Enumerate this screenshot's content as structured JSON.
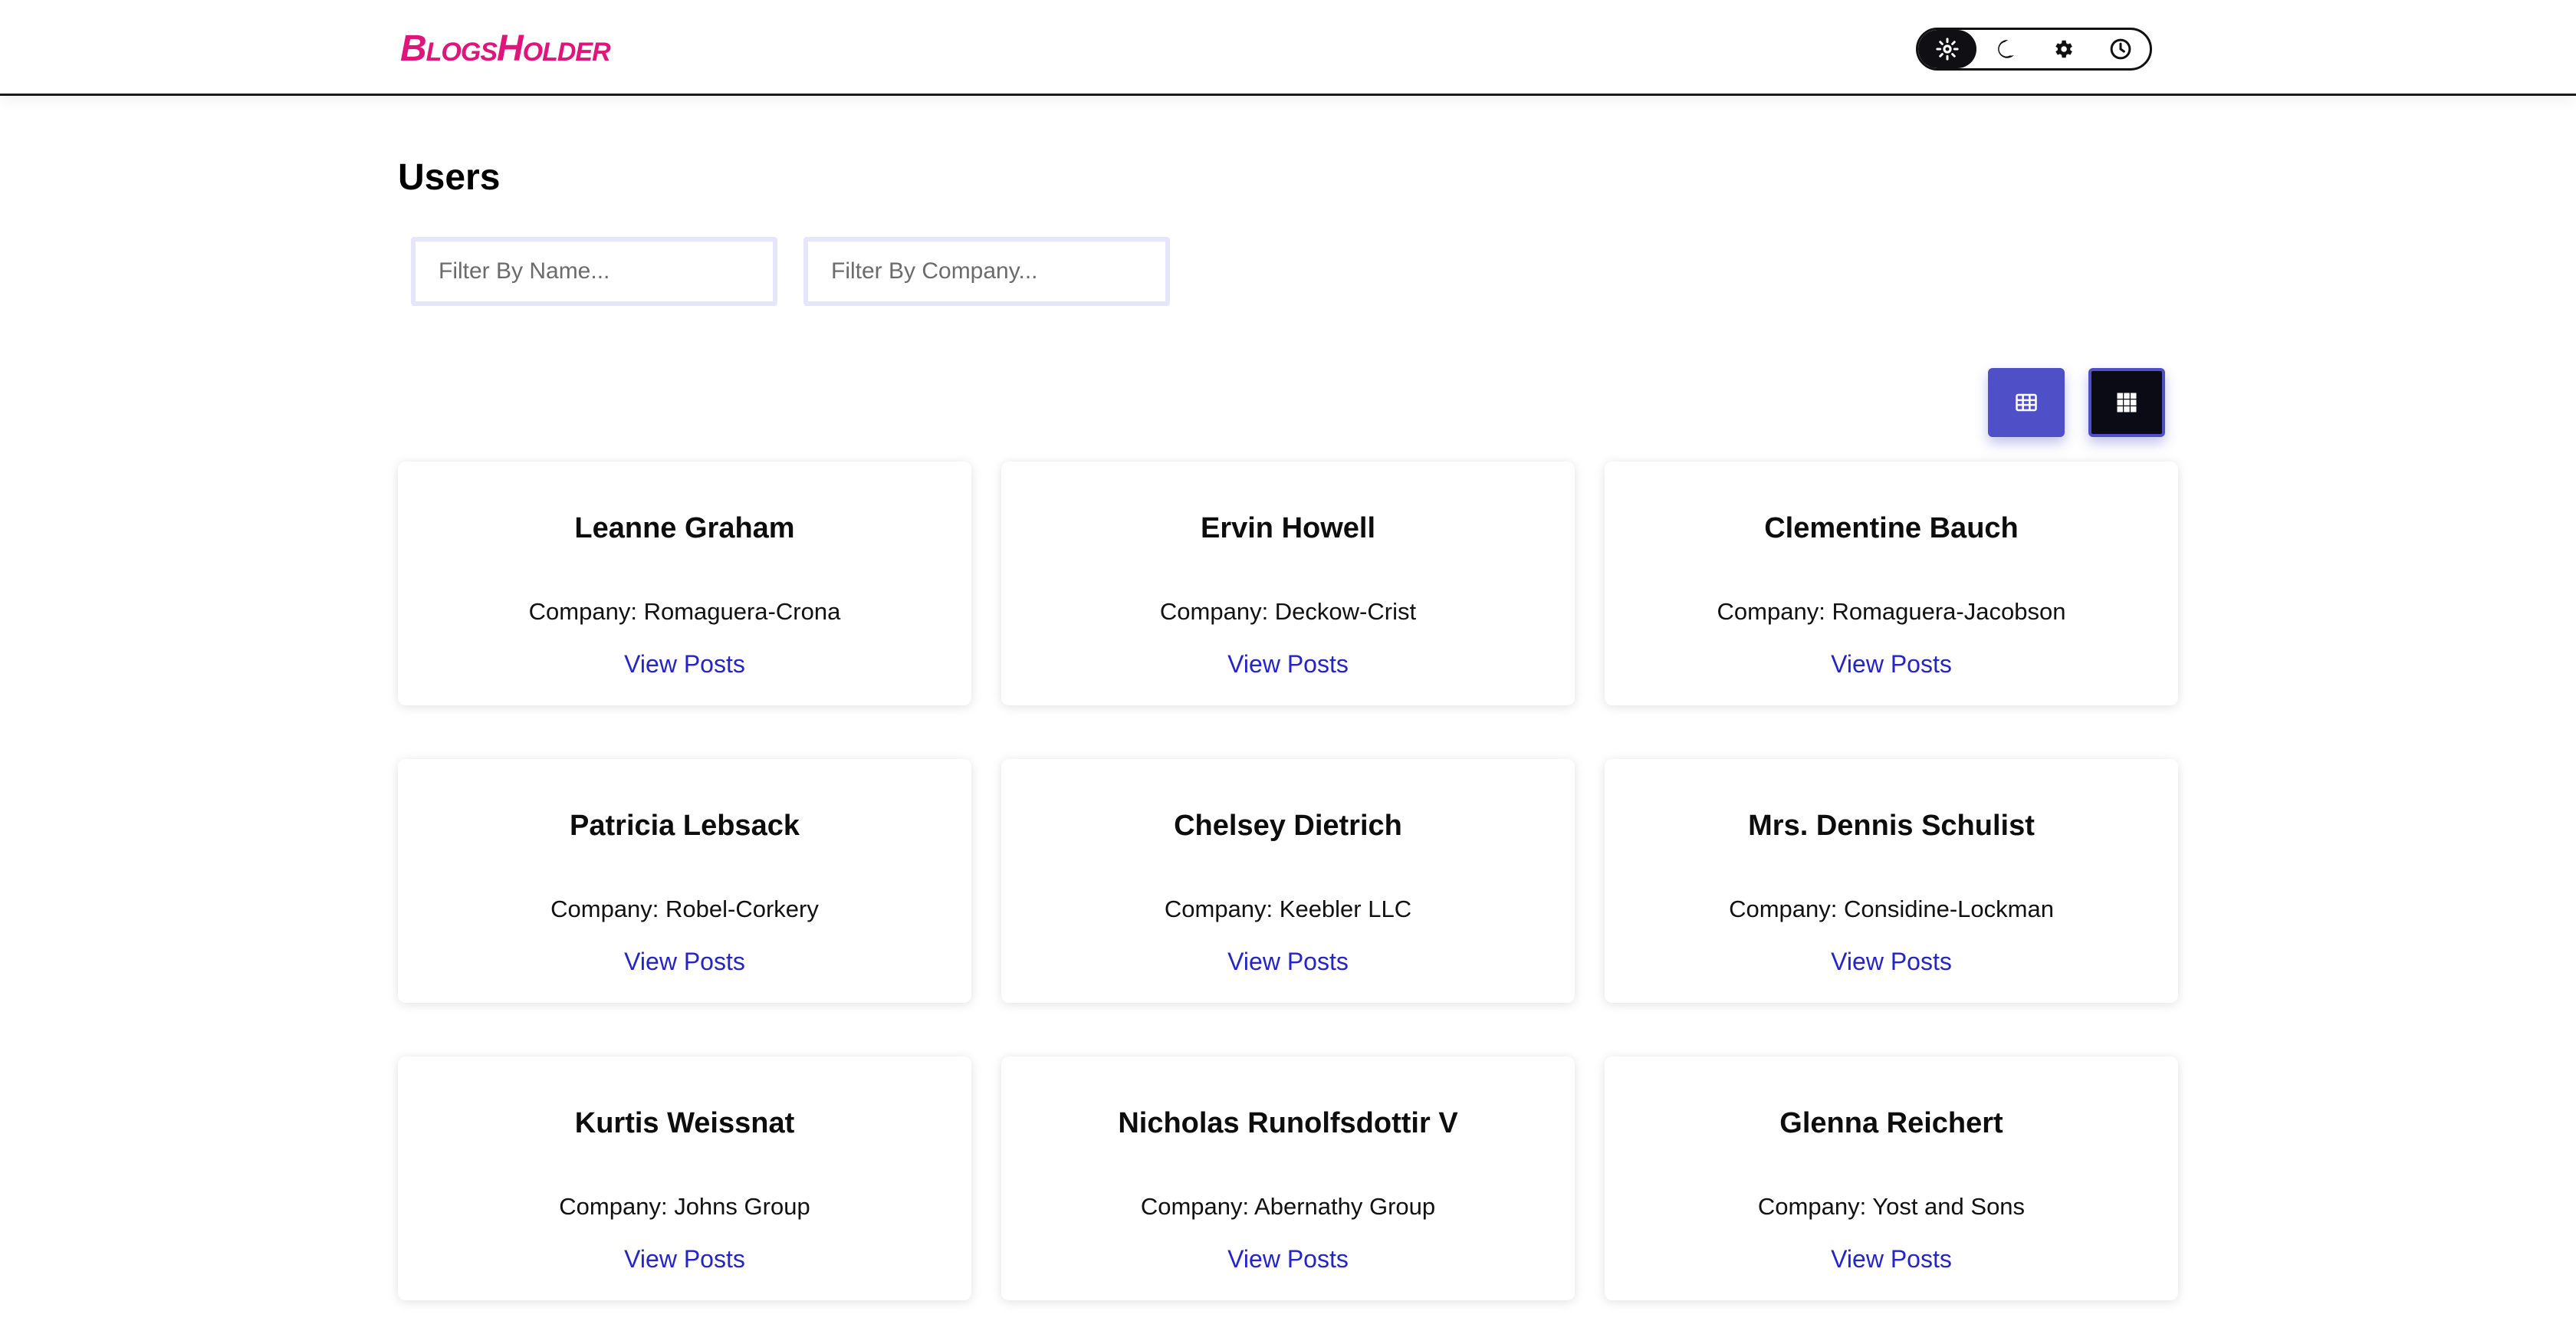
{
  "header": {
    "logo": "BlogsHolder",
    "theme_options": [
      {
        "name": "light",
        "icon": "sun-icon",
        "active": true
      },
      {
        "name": "dark",
        "icon": "moon-icon",
        "active": false
      },
      {
        "name": "settings",
        "icon": "gear-icon",
        "active": false
      },
      {
        "name": "auto",
        "icon": "clock-icon",
        "active": false
      }
    ]
  },
  "main": {
    "title": "Users",
    "filters": {
      "name_placeholder": "Filter By Name...",
      "company_placeholder": "Filter By Company..."
    },
    "view_toggle": {
      "table_icon": "table-icon",
      "grid_icon": "grid-icon",
      "active": "grid"
    },
    "cards": [
      {
        "name": "Leanne Graham",
        "company": "Company: Romaguera-Crona",
        "link": "View Posts"
      },
      {
        "name": "Ervin Howell",
        "company": "Company: Deckow-Crist",
        "link": "View Posts"
      },
      {
        "name": "Clementine Bauch",
        "company": "Company: Romaguera-Jacobson",
        "link": "View Posts"
      },
      {
        "name": "Patricia Lebsack",
        "company": "Company: Robel-Corkery",
        "link": "View Posts"
      },
      {
        "name": "Chelsey Dietrich",
        "company": "Company: Keebler LLC",
        "link": "View Posts"
      },
      {
        "name": "Mrs. Dennis Schulist",
        "company": "Company: Considine-Lockman",
        "link": "View Posts"
      },
      {
        "name": "Kurtis Weissnat",
        "company": "Company: Johns Group",
        "link": "View Posts"
      },
      {
        "name": "Nicholas Runolfsdottir V",
        "company": "Company: Abernathy Group",
        "link": "View Posts"
      },
      {
        "name": "Glenna Reichert",
        "company": "Company: Yost and Sons",
        "link": "View Posts"
      }
    ]
  },
  "colors": {
    "brand": "#e0157c",
    "accent": "#4f50c8",
    "link": "#2424c7",
    "dark": "#0b0b16"
  }
}
